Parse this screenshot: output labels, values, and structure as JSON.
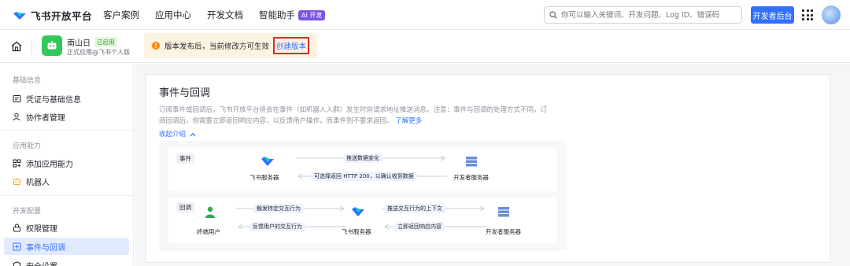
{
  "topnav": {
    "logo_text": "飞书开放平台",
    "links": [
      "客户案例",
      "应用中心",
      "开发文档",
      "智能助手"
    ],
    "ai_badge": "AI 开发",
    "search_placeholder": "你可以输入关键词、开发问题、Log ID、错误码",
    "dev_button": "开发者后台"
  },
  "subbar": {
    "app_name": "南山日",
    "app_badge": "已启用",
    "app_sub": "正式应用@飞书个人版",
    "notice_text": "版本发布后，当前修改方可生效",
    "create_version": "创建版本"
  },
  "sidebar": {
    "group_basic": "基础信息",
    "item_credentials": "凭证与基础信息",
    "item_collaborators": "协作者管理",
    "group_capabilities": "应用能力",
    "item_add_capability": "添加应用能力",
    "item_bot": "机器人",
    "group_dev_config": "开发配置",
    "item_permissions": "权限管理",
    "item_events": "事件与回调",
    "item_security": "安全设置"
  },
  "main": {
    "title": "事件与回调",
    "desc": "订阅事件或回调后，飞书开放平台将会在事件（如机器人入群）发生时向请求地址推送消息。注意：事件与回调的处理方式不同，订阅回调后，你需要立即返回响应内容，以反馈用户操作，而事件则不要求返回。",
    "learn_more": "了解更多",
    "collapse": "收起介绍",
    "diagram": {
      "event_tag": "事件",
      "callback_tag": "回调",
      "feishu_server": "飞书服务器",
      "dev_server": "开发者服务器",
      "end_user": "终端用户",
      "push_change": "推送数据变化",
      "return_200": "可选择返回 HTTP 200，以确认收到数据",
      "trigger_interact": "触发特定交互行为",
      "feedback_interact": "反馈用户的交互行为",
      "push_context": "推送交互行为的上下文",
      "return_response": "立即返回响应内容"
    }
  },
  "colors": {
    "accent": "#3370ff",
    "active_bg": "#e1eaff",
    "notice_bg": "#fdf3e2",
    "highlight_border": "#d0322d",
    "app_icon": "#34c759"
  }
}
